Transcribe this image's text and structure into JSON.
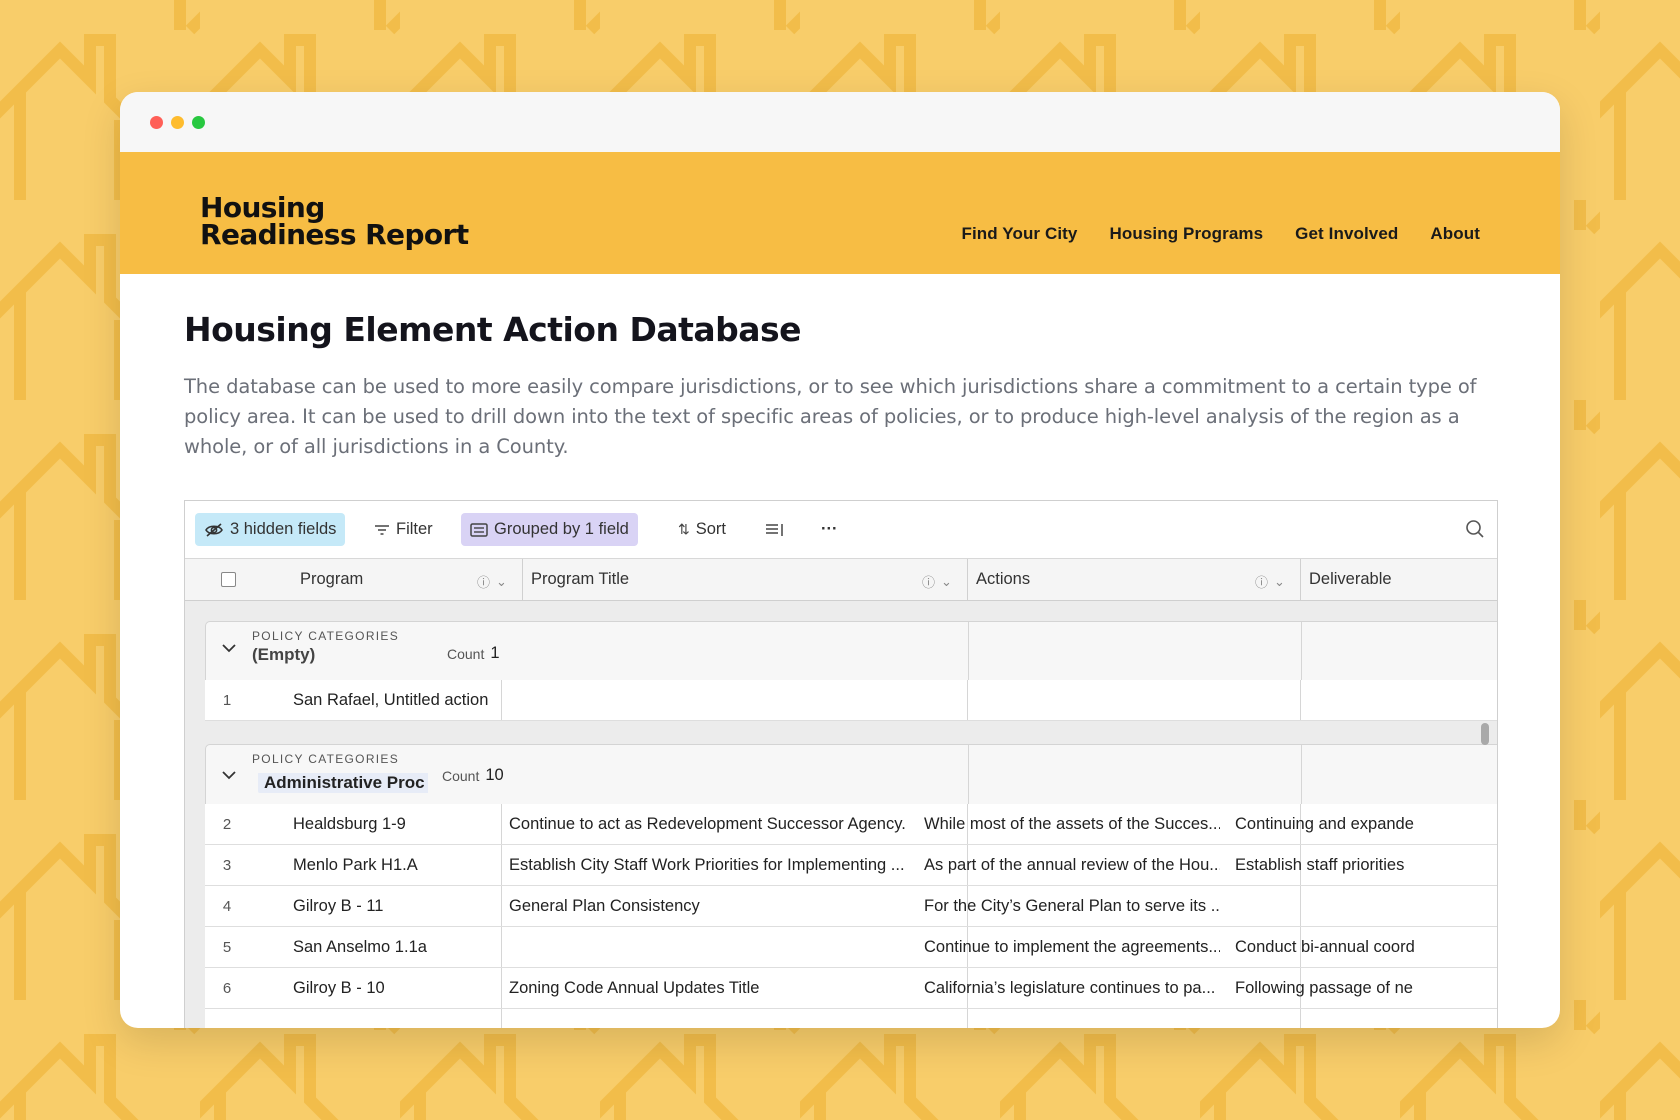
{
  "colors": {
    "background": "#f8cd6a",
    "header": "#f7bd44",
    "hidden_fields_bg": "#c5e9f8",
    "grouped_bg": "#d9d3f5"
  },
  "site": {
    "logo_line1": "Housing",
    "logo_line2": "Readiness Report",
    "nav": [
      "Find Your City",
      "Housing Programs",
      "Get Involved",
      "About"
    ]
  },
  "page": {
    "title": "Housing Element Action Database",
    "description": "The database can be used to more easily compare jurisdictions, or to see which jurisdictions share a commitment to a certain type of policy area. It can be used to drill down into the text of specific areas of policies, or to produce high-level analysis of the region as a whole, or of all jurisdictions in a County."
  },
  "toolbar": {
    "hidden_fields": "3 hidden fields",
    "filter": "Filter",
    "grouped": "Grouped by 1 field",
    "sort": "Sort",
    "more": "···"
  },
  "columns": [
    "Program",
    "Program Title",
    "Actions",
    "Deliverable"
  ],
  "groups": [
    {
      "label": "POLICY CATEGORIES",
      "value": "(Empty)",
      "count_label": "Count",
      "count": "1",
      "rows": [
        {
          "num": "1",
          "program": "San Rafael, Untitled action",
          "title": "",
          "actions": "",
          "deliverable": ""
        }
      ]
    },
    {
      "label": "POLICY CATEGORIES",
      "value": "Administrative Proc",
      "count_label": "Count",
      "count": "10",
      "rows": [
        {
          "num": "2",
          "program": "Healdsburg 1-9",
          "title": "Continue to act as Redevelopment Successor Agency.",
          "actions": "While most of the assets of the Succes...",
          "deliverable": "Continuing and expande"
        },
        {
          "num": "3",
          "program": "Menlo Park H1.A",
          "title": "Establish City Staff Work Priorities for Implementing ...",
          "actions": "As part of the annual review of the Hou...",
          "deliverable": "Establish staff priorities"
        },
        {
          "num": "4",
          "program": "Gilroy B - 11",
          "title": "General Plan Consistency",
          "actions": "For the City’s General Plan to serve its ...",
          "deliverable": ""
        },
        {
          "num": "5",
          "program": "San Anselmo 1.1a",
          "title": "",
          "actions": "Continue to implement the agreements...",
          "deliverable": "Conduct bi-annual coord"
        },
        {
          "num": "6",
          "program": "Gilroy B - 10",
          "title": "Zoning Code Annual Updates Title",
          "actions": "California’s legislature continues to pa...",
          "deliverable": "Following passage of ne"
        }
      ]
    }
  ]
}
